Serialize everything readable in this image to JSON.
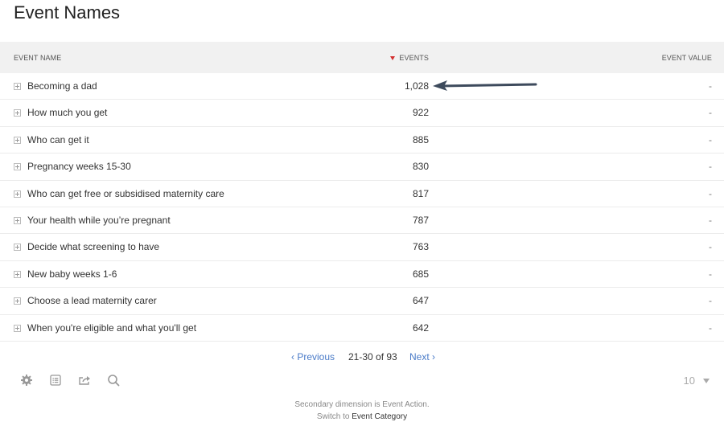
{
  "page_title": "Event Names",
  "table": {
    "headers": {
      "name": "EVENT NAME",
      "events": "EVENTS",
      "value": "EVENT VALUE"
    },
    "sort": {
      "column": "events",
      "direction": "descending",
      "indicator_color": "#d32f2f"
    },
    "rows": [
      {
        "name": "Becoming a dad",
        "events": "1,028",
        "value": "-"
      },
      {
        "name": "How much you get",
        "events": "922",
        "value": "-"
      },
      {
        "name": "Who can get it",
        "events": "885",
        "value": "-"
      },
      {
        "name": "Pregnancy weeks 15-30",
        "events": "830",
        "value": "-"
      },
      {
        "name": "Who can get free or subsidised maternity care",
        "events": "817",
        "value": "-"
      },
      {
        "name": "Your health while you’re pregnant",
        "events": "787",
        "value": "-"
      },
      {
        "name": "Decide what screening to have",
        "events": "763",
        "value": "-"
      },
      {
        "name": "New baby weeks 1-6",
        "events": "685",
        "value": "-"
      },
      {
        "name": "Choose a lead maternity carer",
        "events": "647",
        "value": "-"
      },
      {
        "name": "When you're eligible and what you'll get",
        "events": "642",
        "value": "-"
      }
    ]
  },
  "annotation": {
    "type": "arrow",
    "points_to": "Becoming a dad events 1,028",
    "color": "#3d4a5c"
  },
  "pagination": {
    "previous_label": "‹ Previous",
    "range_label": "21-30 of 93",
    "next_label": "Next ›"
  },
  "toolbar": {
    "icons": [
      "settings-icon",
      "table-view-icon",
      "export-icon",
      "search-icon"
    ]
  },
  "rows_per_page": {
    "value": "10"
  },
  "footer": {
    "secondary_dimension_text": "Secondary dimension is Event Action.",
    "switch_prefix": "Switch to ",
    "switch_link": "Event Category"
  }
}
